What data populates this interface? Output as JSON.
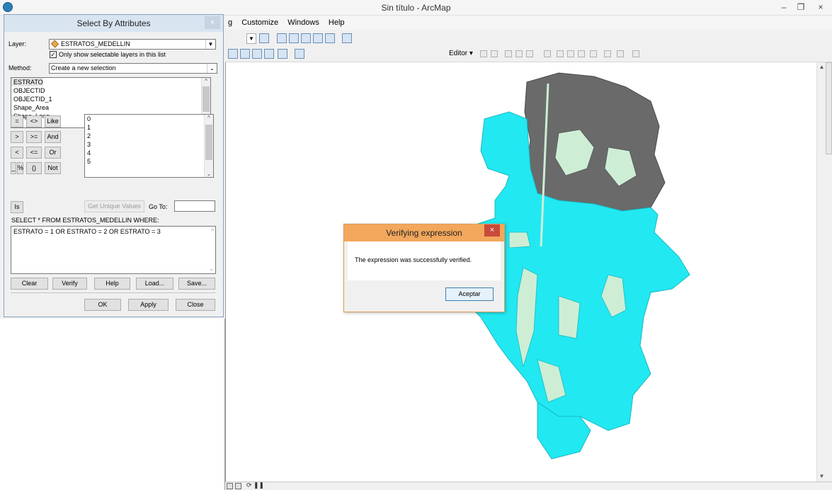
{
  "window": {
    "title": "Sin título - ArcMap",
    "minimize": "–",
    "maximize": "❐",
    "close": "×"
  },
  "menu": {
    "items": [
      "g",
      "Customize",
      "Windows",
      "Help"
    ]
  },
  "toolbar": {
    "editor_label": "Editor ▾"
  },
  "select_by_attributes": {
    "title": "Select By Attributes",
    "close": "×",
    "layer_label": "Layer:",
    "layer_value": "ESTRATOS_MEDELLIN",
    "only_selectable_label": "Only show selectable layers in this list",
    "only_selectable_checked": "✓",
    "method_label": "Method:",
    "method_value": "Create a new selection",
    "fields": [
      "ESTRATO",
      "OBJECTID",
      "OBJECTID_1",
      "Shape_Area",
      "Shape_Leng"
    ],
    "operators": {
      "eq": "=",
      "ne": "<>",
      "like": "Like",
      "gt": ">",
      "ge": ">=",
      "and": "And",
      "lt": "<",
      "le": "<=",
      "or": "Or",
      "underscore": "_",
      "percent": "%",
      "parens": "()",
      "not": "Not",
      "is": "Is"
    },
    "values": [
      "0",
      "1",
      "2",
      "3",
      "4",
      "5"
    ],
    "get_unique_values": "Get Unique Values",
    "go_to_label": "Go To:",
    "go_to_value": "",
    "sql_prefix": "SELECT * FROM ESTRATOS_MEDELLIN WHERE:",
    "expression": "ESTRATO = 1 OR ESTRATO = 2 OR ESTRATO = 3",
    "buttons": {
      "clear": "Clear",
      "verify": "Verify",
      "help": "Help",
      "load": "Load...",
      "save": "Save...",
      "ok": "OK",
      "apply": "Apply",
      "close": "Close"
    }
  },
  "verify_dialog": {
    "title": "Verifying expression",
    "close": "×",
    "message": "The expression was successfully verified.",
    "ok": "Aceptar"
  },
  "map": {
    "selected_color": "#22e8f2",
    "unselected_color": "#cdeed5",
    "outline_color": "#5a5a5a"
  }
}
